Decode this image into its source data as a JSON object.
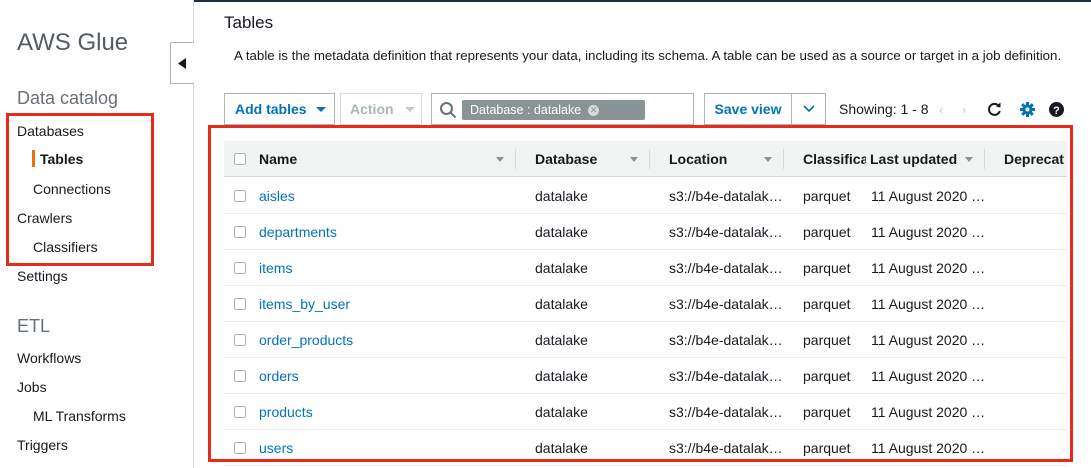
{
  "sidebar": {
    "brand": "AWS Glue",
    "data_catalog_title": "Data catalog",
    "items": {
      "databases": "Databases",
      "tables": "Tables",
      "connections": "Connections",
      "crawlers": "Crawlers",
      "classifiers": "Classifiers",
      "settings": "Settings"
    },
    "etl_title": "ETL",
    "etl_items": {
      "workflows": "Workflows",
      "jobs": "Jobs",
      "ml_transforms": "ML Transforms",
      "triggers": "Triggers"
    },
    "collapse_icon": "caret-left-icon"
  },
  "main": {
    "title": "Tables",
    "description": "A table is the metadata definition that represents your data, including its schema. A table can be used as a source or target in a job definition.",
    "toolbar": {
      "add_tables": "Add tables",
      "action": "Action",
      "search_token": "Database : datalake",
      "save_view": "Save view",
      "showing": "Showing: 1 - 8",
      "prev": "‹",
      "next": "›",
      "icons": [
        "search-icon",
        "refresh-icon",
        "gear-icon",
        "help-icon"
      ]
    },
    "table": {
      "columns": {
        "name": "Name",
        "database": "Database",
        "location": "Location",
        "classification": "Classifica",
        "last_updated": "Last updated",
        "deprecated": "Deprecat"
      },
      "rows": [
        {
          "name": "aisles",
          "database": "datalake",
          "location": "s3://b4e-datalak…",
          "classification": "parquet",
          "last_updated": "11 August 2020 …"
        },
        {
          "name": "departments",
          "database": "datalake",
          "location": "s3://b4e-datalak…",
          "classification": "parquet",
          "last_updated": "11 August 2020 …"
        },
        {
          "name": "items",
          "database": "datalake",
          "location": "s3://b4e-datalak…",
          "classification": "parquet",
          "last_updated": "11 August 2020 …"
        },
        {
          "name": "items_by_user",
          "database": "datalake",
          "location": "s3://b4e-datalak…",
          "classification": "parquet",
          "last_updated": "11 August 2020 …"
        },
        {
          "name": "order_products",
          "database": "datalake",
          "location": "s3://b4e-datalak…",
          "classification": "parquet",
          "last_updated": "11 August 2020 …"
        },
        {
          "name": "orders",
          "database": "datalake",
          "location": "s3://b4e-datalak…",
          "classification": "parquet",
          "last_updated": "11 August 2020 …"
        },
        {
          "name": "products",
          "database": "datalake",
          "location": "s3://b4e-datalak…",
          "classification": "parquet",
          "last_updated": "11 August 2020 …"
        },
        {
          "name": "users",
          "database": "datalake",
          "location": "s3://b4e-datalak…",
          "classification": "parquet",
          "last_updated": "11 August 2020 …"
        }
      ]
    }
  },
  "colors": {
    "link": "#0073bb",
    "active_accent": "#ec7211",
    "highlight": "#e8291c"
  }
}
